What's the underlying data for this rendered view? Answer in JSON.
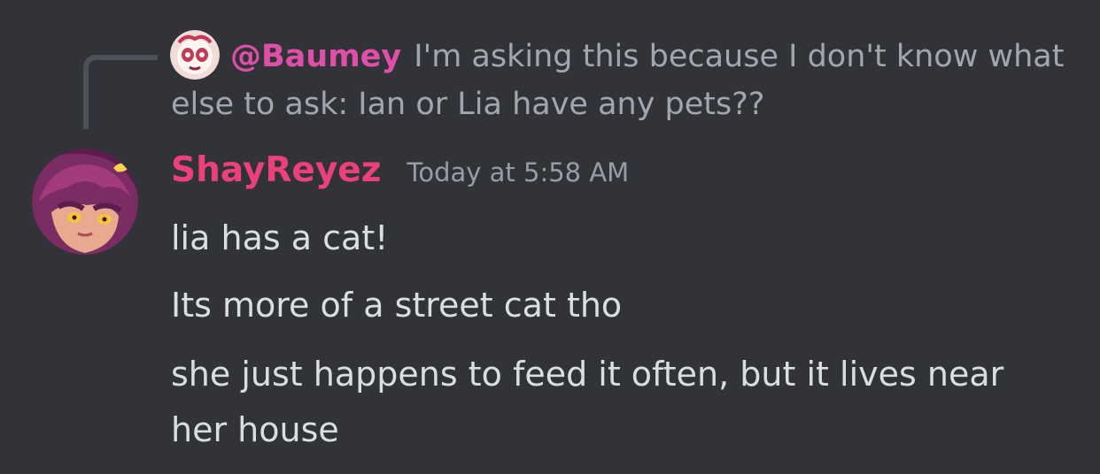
{
  "reply": {
    "author": "@Baumey",
    "text": "I'm asking this because I don't know what else to ask: Ian or Lia have any pets??",
    "avatar_icon": "reply-user-avatar-icon"
  },
  "message": {
    "author": "ShayReyez",
    "timestamp": "Today at 5:58 AM",
    "avatar_icon": "user-avatar-icon",
    "lines": [
      "lia has a cat!",
      "Its more of a street cat tho",
      "she just happens to feed it often, but it lives near her house"
    ]
  },
  "colors": {
    "background": "#313338",
    "reply_author": "#e04fa7",
    "author": "#ec407a",
    "text": "#dbdee1",
    "muted": "#a4a6ad"
  }
}
